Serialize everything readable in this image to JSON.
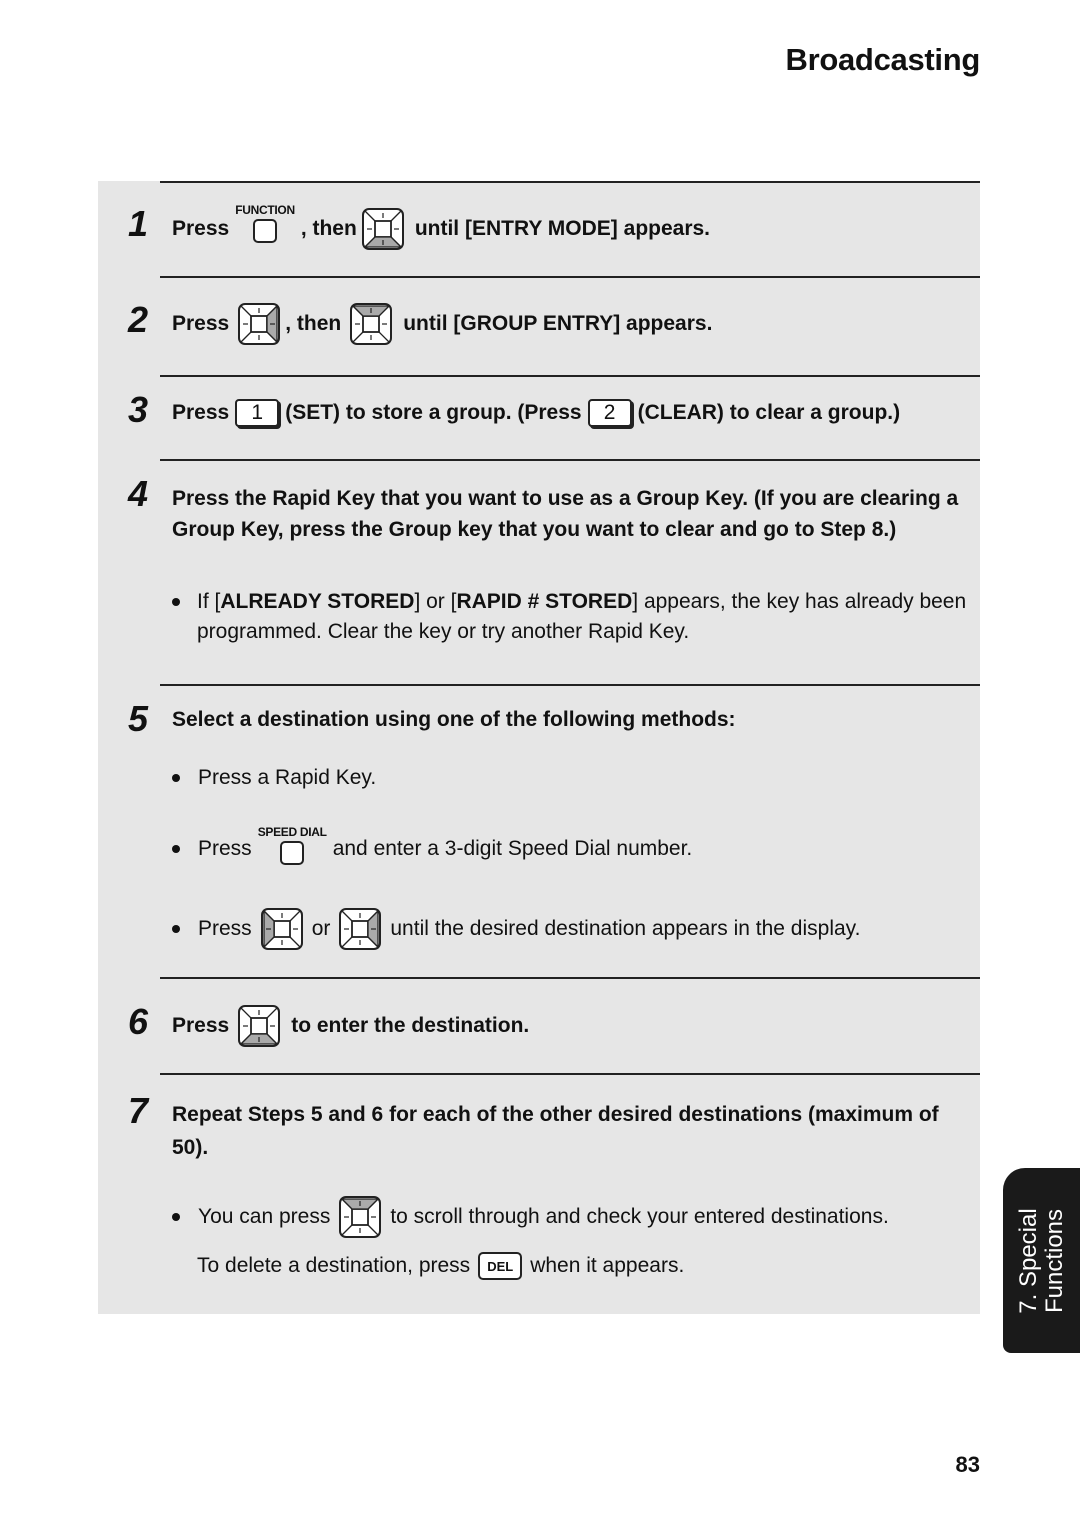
{
  "header": {
    "title": "Broadcasting"
  },
  "steps": [
    {
      "number": "1",
      "press": "Press",
      "key_label": "FUNCTION",
      "then": ", then",
      "text": "until [ENTRY MODE] appears."
    },
    {
      "number": "2",
      "press": "Press",
      "then": ", then",
      "text": "until [GROUP ENTRY] appears."
    },
    {
      "number": "3",
      "press": "Press",
      "key1": "1",
      "text1": "(SET) to store a group. (Press",
      "key2": "2",
      "text2": "(CLEAR) to clear a group.)"
    },
    {
      "number": "4",
      "text": "Press the Rapid Key that you want to use as a Group Key. (If you are clearing a Group Key, press the Group key that you want to clear and go to Step 8.)",
      "bullet": {
        "pre": "If [",
        "b1": "ALREADY STORED",
        "mid": "] or [",
        "b2": "RAPID # STORED",
        "post": "] appears, the key has already been programmed. Clear the key or try another Rapid Key."
      }
    },
    {
      "number": "5",
      "text": "Select a destination using one of the following methods:",
      "bullets": [
        {
          "text": "Press a Rapid Key."
        },
        {
          "press": "Press",
          "key_label": "SPEED DIAL",
          "text": "and enter a 3-digit Speed Dial number."
        },
        {
          "press": "Press",
          "or": "or",
          "text": "until the desired  destination appears in the display."
        }
      ]
    },
    {
      "number": "6",
      "press": "Press",
      "text": "to enter the destination."
    },
    {
      "number": "7",
      "text": "Repeat Steps 5 and 6 for each of the other desired destinations (maximum of 50).",
      "bullet": {
        "pre": "You can press",
        "post": "to scroll through and check your entered destinations.",
        "line2_pre": "To delete a destination, press",
        "del_key": "DEL",
        "line2_post": "when it appears."
      }
    }
  ],
  "icons": {
    "nav_key": "navigation-key-icon",
    "function_key": "function-key-icon",
    "speed_dial_key": "speed-dial-key-icon"
  },
  "side_tab": {
    "line1": "7. Special",
    "line2": "Functions"
  },
  "page_number": "83"
}
